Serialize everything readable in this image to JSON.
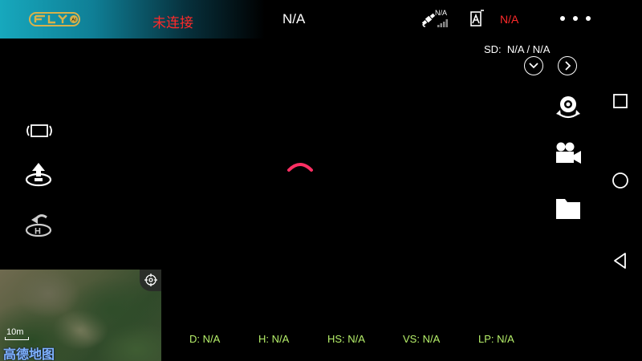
{
  "topbar": {
    "connection_status": "未连接",
    "center_status": "N/A",
    "gps_text": "N/A",
    "rc_text": "N/A"
  },
  "storage": {
    "sd_label": "SD:",
    "sd_value": "N/A / N/A"
  },
  "map": {
    "scale_label": "10m",
    "brand": "高德地图"
  },
  "telemetry": [
    {
      "label": "D:",
      "value": "N/A"
    },
    {
      "label": "H:",
      "value": "N/A"
    },
    {
      "label": "HS:",
      "value": "N/A"
    },
    {
      "label": "VS:",
      "value": "N/A"
    },
    {
      "label": "LP:",
      "value": "N/A"
    }
  ],
  "colors": {
    "accent_teal": "#17a8bd",
    "alert_red": "#ff2a2a",
    "telemetry_green": "#b6f06a",
    "spinner_pink": "#ff2f63"
  },
  "icons": {
    "left": [
      "gimbal-reset-icon",
      "takeoff-icon",
      "return-home-icon"
    ],
    "right": [
      "camera-mode-icon",
      "video-record-icon",
      "gallery-folder-icon"
    ],
    "nav": [
      "recent-apps-icon",
      "home-nav-icon",
      "back-nav-icon"
    ]
  }
}
